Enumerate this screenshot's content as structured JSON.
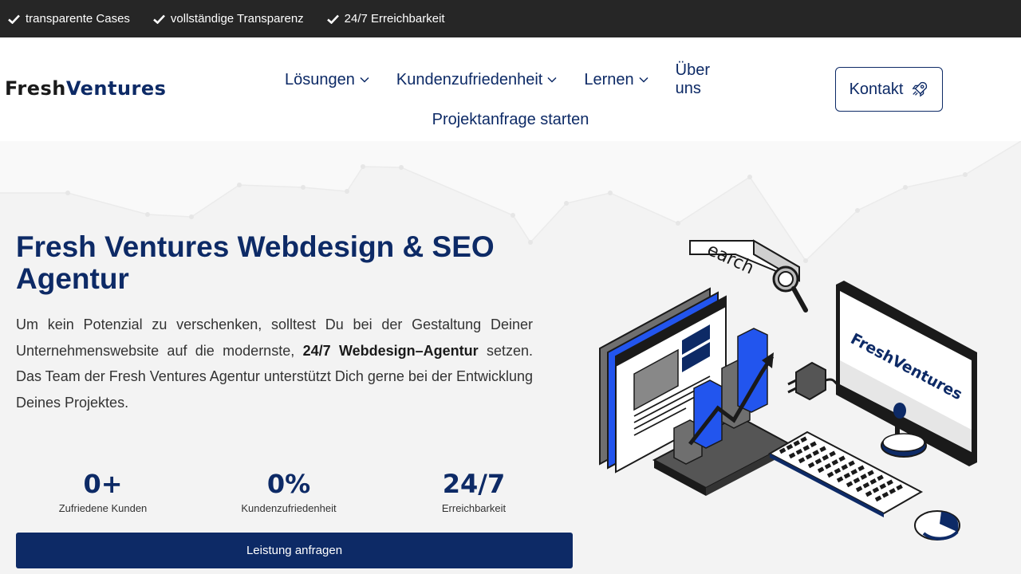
{
  "topbar": {
    "items": [
      "transparente Cases",
      "vollständige Transparenz",
      "24/7 Erreichbarkeit"
    ]
  },
  "logo": {
    "part1": "Fresh",
    "part2": "Ventures"
  },
  "nav": {
    "items": [
      {
        "label": "Lösungen"
      },
      {
        "label": "Kundenzufriedenheit"
      },
      {
        "label": "Lernen"
      },
      {
        "label": "Über uns"
      },
      {
        "label": "Projektanfrage starten"
      }
    ]
  },
  "kontakt": {
    "label": "Kontakt"
  },
  "hero": {
    "title": "Fresh Ventures Webdesign & SEO Agentur",
    "para_1": "Um kein Potenzial zu verschenken, solltest Du bei der Gestaltung Deiner Unternehmenswebsite auf die modernste, ",
    "para_bold": "24/7 Webdesign–Agentur",
    "para_2": " setzen. Das Team der Fresh Ventures Agentur unterstützt Dich gerne bei der Entwicklung Deines Projektes."
  },
  "stats": [
    {
      "value": "0+",
      "label": "Zufriedene Kunden"
    },
    {
      "value": "0%",
      "label": "Kundenzufriedenheit"
    },
    {
      "value": "24/7",
      "label": "Erreichbarkeit"
    }
  ],
  "cta": {
    "label": "Leistung anfragen"
  },
  "illustration": {
    "search_text": "earch",
    "screen_text": "FreshVentures"
  },
  "colors": {
    "brand": "#0d2a66",
    "topbar": "#262626",
    "accent_blue": "#2255ee"
  },
  "icons": {
    "check": "check-icon",
    "chevron": "chevron-down-icon",
    "rocket": "rocket-icon"
  }
}
